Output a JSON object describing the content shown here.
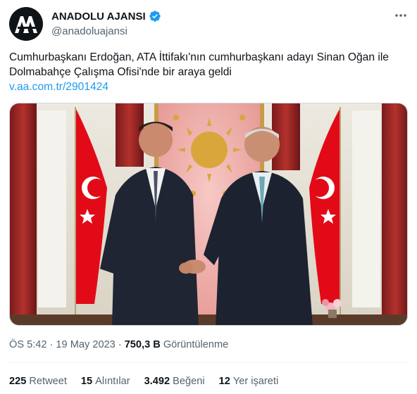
{
  "account": {
    "display_name": "ANADOLU AJANSI",
    "handle": "@anadoluajansi"
  },
  "tweet": {
    "text": "Cumhurbaşkanı Erdoğan, ATA İttifakı'nın cumhurbaşkanı adayı Sinan Oğan ile Dolmabahçe Çalışma Ofisi'nde bir araya geldi",
    "link": "v.aa.com.tr/2901424"
  },
  "meta": {
    "time": "ÖS 5:42",
    "separator": "·",
    "date": "19 May 2023",
    "views_count": "750,3 B",
    "views_label": "Görüntülenme"
  },
  "stats": [
    {
      "count": "225",
      "label": "Retweet"
    },
    {
      "count": "15",
      "label": "Alıntılar"
    },
    {
      "count": "3.492",
      "label": "Beğeni"
    },
    {
      "count": "12",
      "label": "Yer işareti"
    }
  ],
  "colors": {
    "verified": "#1d9bf0",
    "link": "#1d9bf0",
    "secondary_text": "#536471",
    "flag_red": "#e30a17"
  },
  "icons": {
    "avatar": "aa-logo",
    "verified": "verified-badge-icon",
    "more": "more-horizontal-icon"
  }
}
